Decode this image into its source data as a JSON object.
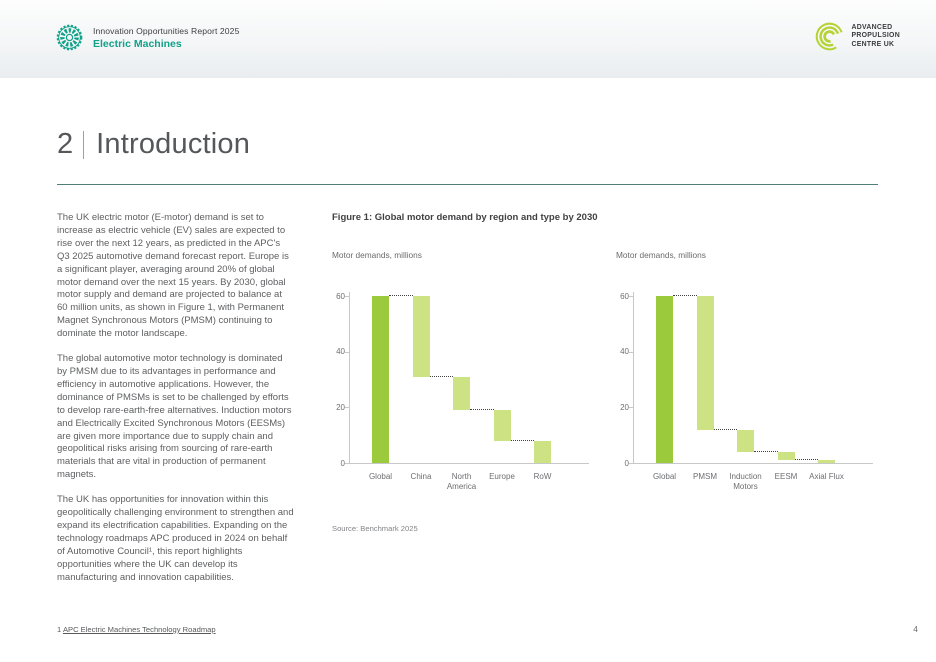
{
  "header": {
    "report_title": "Innovation Opportunities Report 2025",
    "report_subtitle": "Electric Machines",
    "brand_line1": "ADVANCED",
    "brand_line2": "PROPULSION",
    "brand_line3": "CENTRE UK"
  },
  "section": {
    "number": "2",
    "title": "Introduction"
  },
  "paragraphs": {
    "p1": "The UK electric motor (E-motor) demand is set to increase as electric vehicle (EV) sales are expected to rise over the next 12 years, as predicted in the APC's Q3 2025 automotive demand forecast report. Europe is a significant player, averaging around 20% of global motor demand over the next 15 years. By 2030, global motor supply and demand are projected to balance at 60 million units, as shown in Figure 1, with Permanent Magnet Synchronous Motors (PMSM) continuing to dominate the motor landscape.",
    "p2": "The global automotive motor technology is dominated by PMSM due to its advantages in performance and efficiency in automotive applications. However, the dominance of PMSMs is set to be challenged by efforts to develop rare-earth-free alternatives. Induction motors and Electrically Excited Synchronous Motors (EESMs) are given more importance due to supply chain and geopolitical risks arising from sourcing of rare-earth materials that are vital in production of permanent magnets.",
    "p3": "The UK has opportunities for innovation within this geopolitically challenging environment to strengthen and expand its electrification capabilities. Expanding on the technology roadmaps APC produced in 2024 on behalf of Automotive Council¹, this report highlights opportunities where the UK can develop its manufacturing and innovation capabilities."
  },
  "figure": {
    "title": "Figure 1: Global motor demand by region and type by 2030",
    "source": "Source: Benchmark 2025"
  },
  "chart_data": [
    {
      "type": "waterfall",
      "title": "Motor demands, millions",
      "categories": [
        "Global",
        "China",
        "North America",
        "Europe",
        "RoW"
      ],
      "steps": [
        {
          "label": "Global",
          "start": 0,
          "end": 60,
          "value": 60,
          "total": true
        },
        {
          "label": "China",
          "start": 60,
          "end": 31,
          "value": -29
        },
        {
          "label": "North America",
          "start": 31,
          "end": 19,
          "value": -12
        },
        {
          "label": "Europe",
          "start": 19,
          "end": 8,
          "value": -11
        },
        {
          "label": "RoW",
          "start": 8,
          "end": 0,
          "value": -8
        }
      ],
      "ylabel": "Motor demands, millions",
      "ylim": [
        0,
        60
      ],
      "yticks": [
        0,
        20,
        40,
        60
      ],
      "grid": false,
      "legend": false
    },
    {
      "type": "waterfall",
      "title": "Motor demands, millions",
      "categories": [
        "Global",
        "PMSM",
        "Induction Motors",
        "EESM",
        "Axial Flux"
      ],
      "steps": [
        {
          "label": "Global",
          "start": 0,
          "end": 60,
          "value": 60,
          "total": true
        },
        {
          "label": "PMSM",
          "start": 60,
          "end": 12,
          "value": -48
        },
        {
          "label": "Induction Motors",
          "start": 12,
          "end": 4,
          "value": -8
        },
        {
          "label": "EESM",
          "start": 4,
          "end": 1,
          "value": -3
        },
        {
          "label": "Axial Flux",
          "start": 1,
          "end": 0,
          "value": -1
        }
      ],
      "ylabel": "Motor demands, millions",
      "ylim": [
        0,
        60
      ],
      "yticks": [
        0,
        20,
        40,
        60
      ],
      "grid": false,
      "legend": false
    }
  ],
  "colors": {
    "teal": "#12a189",
    "lime": "#b5d334",
    "bar_total": "#9bcb3d",
    "bar_delta": "#cde282",
    "axis_gray": "#c7c8ca",
    "connector": "#3f4041"
  },
  "footnote": {
    "marker": "1",
    "link_text": "APC Electric Machines Technology Roadmap"
  },
  "page_number": "4"
}
